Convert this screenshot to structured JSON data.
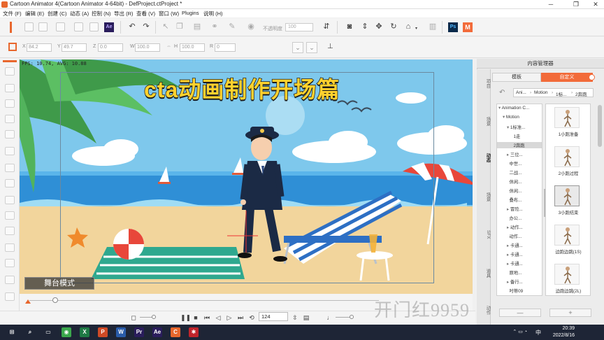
{
  "window": {
    "title": "Cartoon Animator 4(Cartoon Animator 4-64bit) - DefProject.ctProject *",
    "min_icon": "minimize-icon",
    "max_icon": "maximize-icon",
    "close_icon": "close-icon"
  },
  "menu": {
    "items": [
      "文件 (F)",
      "编辑 (E)",
      "创建 (C)",
      "动态 (A)",
      "控制 (N)",
      "导出 (R)",
      "查看 (V)",
      "窗口 (W)",
      "Plugins",
      "说明 (H)"
    ]
  },
  "toolbar": {
    "opacity_label": "不透明度",
    "opacity_value": "100",
    "ps_label": "Ps",
    "ae_label": "Ae",
    "m_label": "M"
  },
  "transform": {
    "x_label": "X",
    "x_value": "84.2",
    "y_label": "Y",
    "y_value": "49.7",
    "z_label": "Z",
    "z_value": "0.0",
    "w_label": "W",
    "w_value": "100.0",
    "h_label": "H",
    "h_value": "100.0",
    "r_label": "R",
    "r_value": "0"
  },
  "stage": {
    "fps_text": "FPS: 10.74, AVG: 10.88",
    "title_art": "cta动画制作开场篇",
    "mode_button": "舞台模式"
  },
  "playback": {
    "current_frame": "124"
  },
  "watermark": "开门红9959",
  "content_manager": {
    "title": "内容管理器",
    "tab_template": "模板",
    "tab_custom": "自定义",
    "breadcrumb": [
      "Ani...",
      "Motion",
      "1标...",
      "2奔跑"
    ],
    "side_tabs": [
      "项目",
      "场景",
      "动态",
      "场景",
      "SFX",
      "道具",
      "动作"
    ],
    "tree": [
      {
        "label": "Animation C...",
        "indent": 0,
        "expand": "▾"
      },
      {
        "label": "Motion",
        "indent": 1,
        "expand": "▾"
      },
      {
        "label": "1标准...",
        "indent": 2,
        "expand": "▾"
      },
      {
        "label": "1走",
        "indent": 3,
        "expand": ""
      },
      {
        "label": "2奔跑",
        "indent": 3,
        "expand": "",
        "selected": true
      },
      {
        "label": "三位...",
        "indent": 2,
        "expand": "▸"
      },
      {
        "label": "中世...",
        "indent": 2,
        "expand": ""
      },
      {
        "label": "二战...",
        "indent": 2,
        "expand": ""
      },
      {
        "label": "休闲...",
        "indent": 2,
        "expand": ""
      },
      {
        "label": "休闲...",
        "indent": 2,
        "expand": ""
      },
      {
        "label": "叠布...",
        "indent": 2,
        "expand": ""
      },
      {
        "label": "冒险...",
        "indent": 2,
        "expand": "▸"
      },
      {
        "label": "办公...",
        "indent": 2,
        "expand": ""
      },
      {
        "label": "动作...",
        "indent": 2,
        "expand": "▸"
      },
      {
        "label": "动作...",
        "indent": 2,
        "expand": ""
      },
      {
        "label": "卡通...",
        "indent": 2,
        "expand": "▸"
      },
      {
        "label": "卡通...",
        "indent": 2,
        "expand": "▸"
      },
      {
        "label": "卡通...",
        "indent": 2,
        "expand": "▸"
      },
      {
        "label": "原地...",
        "indent": 2,
        "expand": ""
      },
      {
        "label": "备行...",
        "indent": 2,
        "expand": "▸"
      },
      {
        "label": "吋蒂09",
        "indent": 2,
        "expand": ""
      }
    ],
    "thumbnails": [
      {
        "label": "1小跑准备",
        "selected": false
      },
      {
        "label": "2小跑过程",
        "selected": false
      },
      {
        "label": "3小跑结束",
        "selected": true
      },
      {
        "label": "边跑边跳(1S)",
        "selected": false
      },
      {
        "label": "边跑边跳(2L)",
        "selected": false
      }
    ],
    "minus_label": "—",
    "plus_label": "+"
  },
  "taskbar": {
    "time": "20:39",
    "date": "2022/8/16",
    "lang": "中",
    "apps": [
      {
        "name": "start",
        "label": "⊞",
        "color": "#1e2536"
      },
      {
        "name": "search",
        "label": "⌕",
        "color": "#1e2536"
      },
      {
        "name": "taskview",
        "label": "▭",
        "color": "#1e2536"
      },
      {
        "name": "app-green",
        "label": "◉",
        "color": "#3aa74c"
      },
      {
        "name": "excel",
        "label": "X",
        "color": "#1f7a45"
      },
      {
        "name": "powerpoint",
        "label": "P",
        "color": "#cf4a26"
      },
      {
        "name": "word",
        "label": "W",
        "color": "#2a5caa"
      },
      {
        "name": "premiere",
        "label": "Pr",
        "color": "#2a1d5c"
      },
      {
        "name": "aftereffects",
        "label": "Ae",
        "color": "#2a1d5c"
      },
      {
        "name": "cartoon-animator",
        "label": "C",
        "color": "#e8672d"
      },
      {
        "name": "app-red",
        "label": "✱",
        "color": "#c0242b"
      }
    ]
  },
  "colors": {
    "accent": "#f26b3a",
    "sky": "#7ec8ec",
    "sand": "#f2d59c",
    "title_yellow": "#ffd22e"
  }
}
